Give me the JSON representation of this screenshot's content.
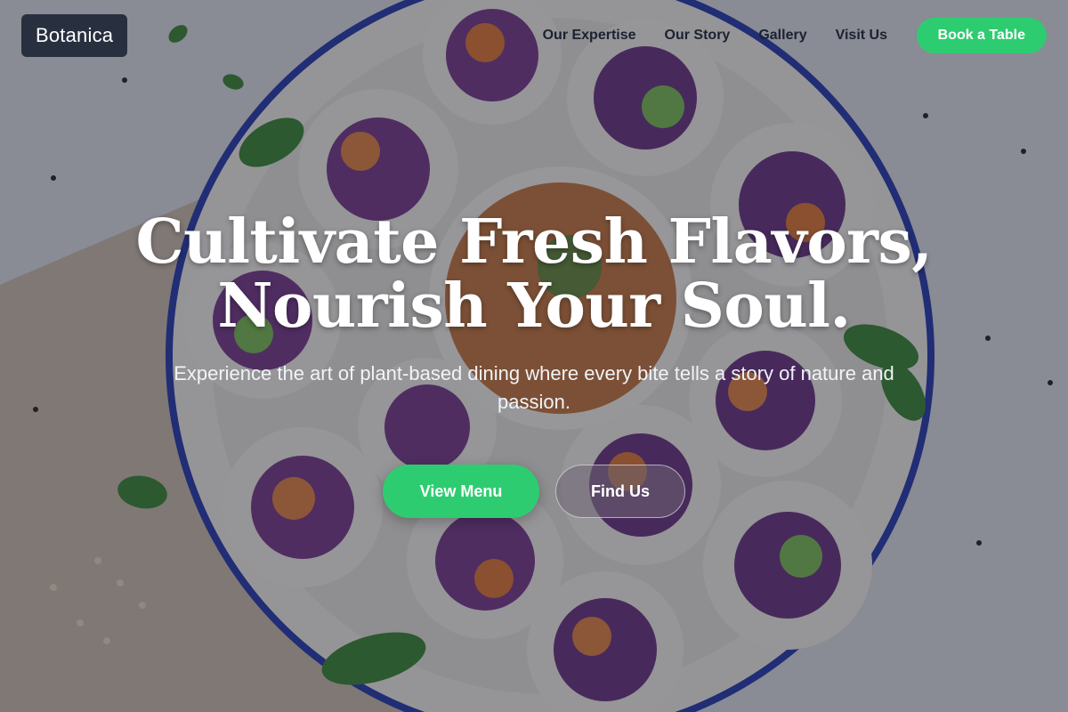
{
  "brand": {
    "name": "Botanica"
  },
  "nav": {
    "items": [
      {
        "label": "Our Expertise"
      },
      {
        "label": "Our Story"
      },
      {
        "label": "Gallery"
      },
      {
        "label": "Visit Us"
      }
    ],
    "cta_label": "Book a Table"
  },
  "hero": {
    "title_line1": "Cultivate Fresh Flavors,",
    "title_line2": "Nourish Your Soul.",
    "subtitle": "Experience the art of plant-based dining where every bite tells a story of nature and passion.",
    "primary_button": "View Menu",
    "secondary_button": "Find Us",
    "background_image": "overhead-plate-of-fresh-spring-rolls-with-dipping-sauce-icon"
  },
  "colors": {
    "accent": "#2ecc71",
    "logo_bg": "#283040",
    "nav_text": "#1b2230",
    "overlay": "rgba(20,22,34,0.42)"
  }
}
